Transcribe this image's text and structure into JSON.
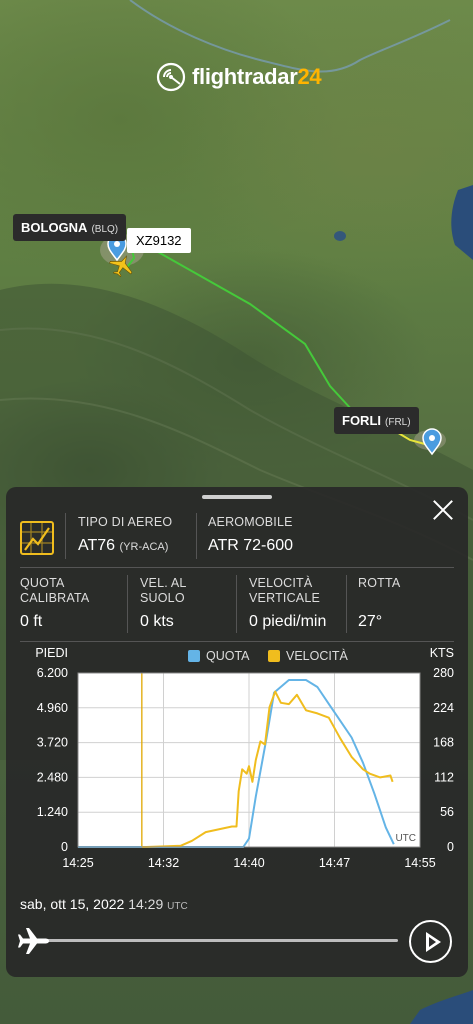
{
  "logo": {
    "text_main": "flightradar",
    "text_num": "24"
  },
  "map": {
    "origin_label": {
      "name": "BOLOGNA",
      "code": "(BLQ)"
    },
    "destination_label": {
      "name": "FORLI",
      "code": "(FRL)"
    },
    "flight_label": "XZ9132"
  },
  "panel": {
    "aircraft_type_label": "TIPO DI AEREO",
    "aircraft_type_value": "AT76",
    "aircraft_type_reg": "(YR-ACA)",
    "aircraft_label": "AEROMOBILE",
    "aircraft_value": "ATR 72-600",
    "stats": [
      {
        "label1": "QUOTA",
        "label2": "CALIBRATA",
        "value": "0 ft"
      },
      {
        "label1": "VEL. AL",
        "label2": "SUOLO",
        "value": "0 kts"
      },
      {
        "label1": "VELOCITÀ",
        "label2": "VERTICALE",
        "value": "0 piedi/min"
      },
      {
        "label1": "ROTTA",
        "label2": "",
        "value": "27°"
      }
    ],
    "date": "sab, ott 15, 2022",
    "time": "14:29",
    "time_unit": "UTC"
  },
  "colors": {
    "quota": "#64b4e6",
    "velocita": "#f0bd1e",
    "route_green": "#45c93a",
    "route_yellow": "#e7e43a",
    "pin": "#4a9ce0"
  },
  "chart_data": {
    "type": "line",
    "left_axis_label": "PIEDI",
    "right_axis_label": "KTS",
    "x_unit_label": "UTC",
    "x_ticks": [
      "14:25",
      "14:32",
      "14:40",
      "14:47",
      "14:55"
    ],
    "y_left_ticks": [
      "0",
      "1.240",
      "2.480",
      "3.720",
      "4.960",
      "6.200"
    ],
    "y_right_ticks": [
      "0",
      "56",
      "112",
      "168",
      "224",
      "280"
    ],
    "ylim_left": [
      0,
      6200
    ],
    "ylim_right": [
      0,
      280
    ],
    "xlim_min": [
      0,
      30
    ],
    "grid": true,
    "legend_position": "top",
    "series": [
      {
        "name": "QUOTA",
        "axis": "left",
        "x": [
          0,
          5.6,
          14.5,
          15.0,
          15.6,
          16.5,
          17.2,
          18.5,
          19.0,
          20.0,
          21.0,
          22.0,
          23.0,
          24.0,
          25.0,
          26.0,
          27.0,
          27.7
        ],
        "y": [
          0,
          0,
          0,
          300,
          1800,
          3800,
          5500,
          5950,
          5950,
          5950,
          5700,
          5100,
          4500,
          3900,
          3000,
          1900,
          700,
          100
        ]
      },
      {
        "name": "VELOCITÀ",
        "axis": "right",
        "x": [
          5.6,
          6.0,
          9.0,
          10.0,
          11.2,
          13.5,
          13.9,
          14.1,
          14.4,
          14.8,
          15.0,
          15.3,
          15.6,
          16.0,
          16.4,
          16.8,
          17.3,
          17.8,
          18.5,
          19.2,
          20.0,
          21.0,
          22.0,
          23.0,
          24.0,
          25.0,
          25.6,
          26.5,
          27.4,
          27.6
        ],
        "y": [
          0,
          0,
          2,
          10,
          24,
          33,
          33,
          90,
          125,
          118,
          130,
          105,
          140,
          170,
          165,
          225,
          250,
          232,
          230,
          245,
          220,
          215,
          208,
          175,
          145,
          125,
          118,
          112,
          115,
          105
        ]
      }
    ]
  }
}
